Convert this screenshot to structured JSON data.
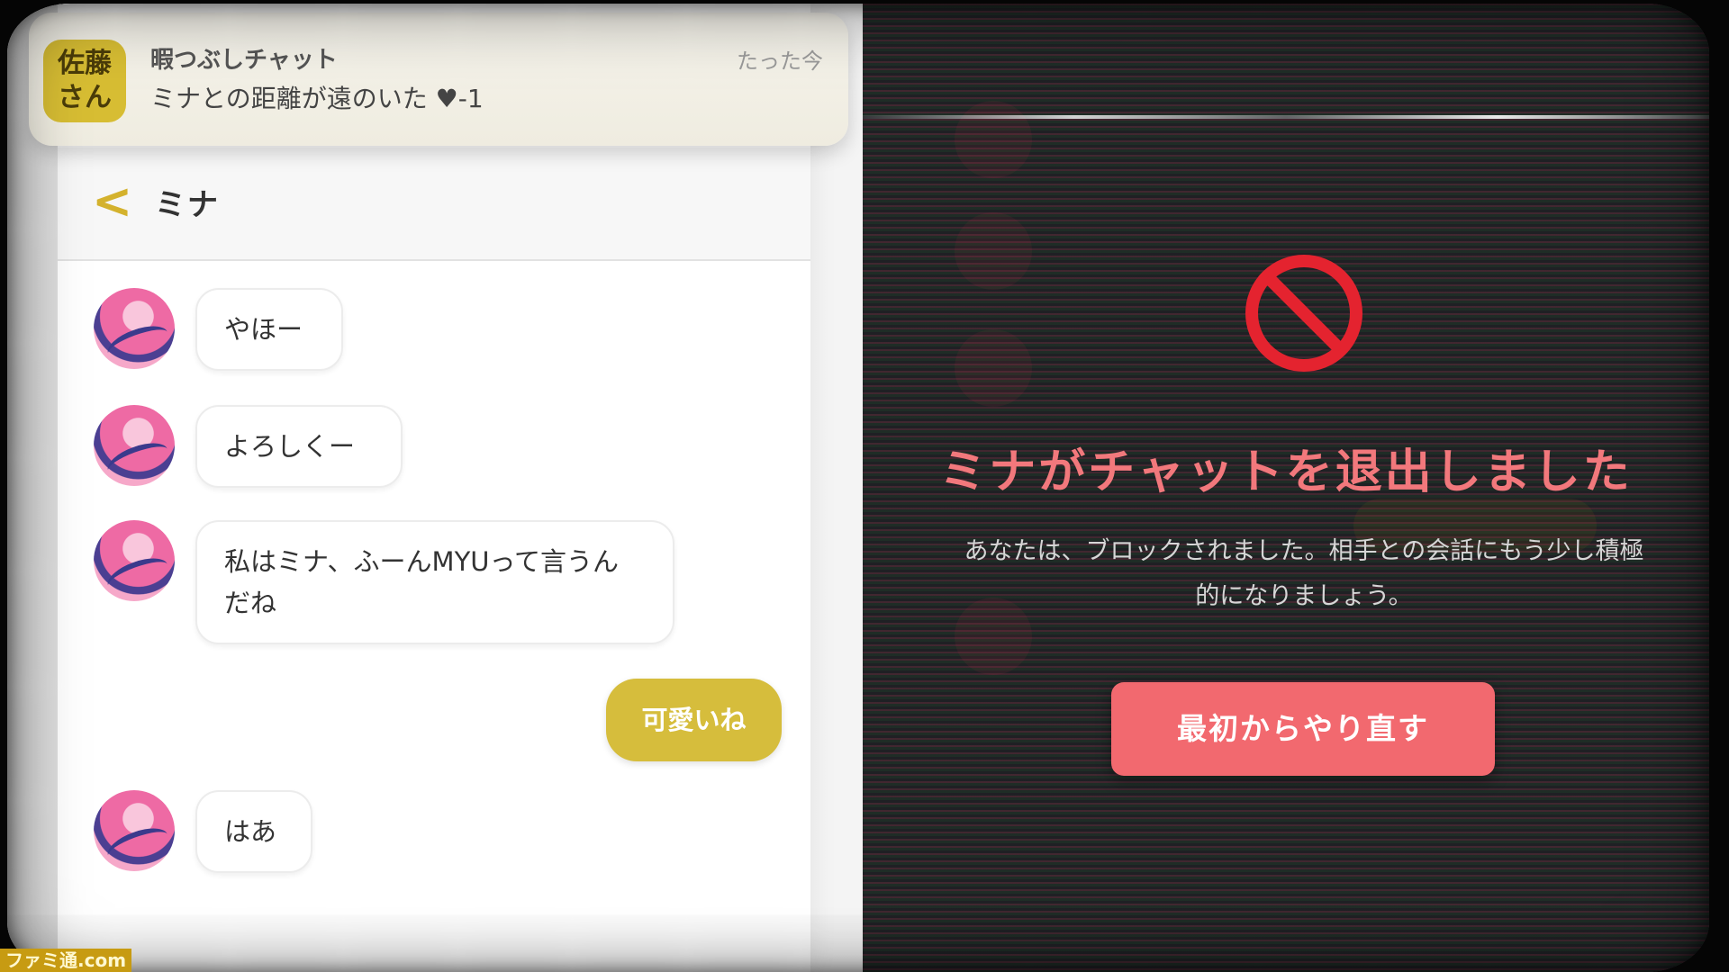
{
  "notification": {
    "avatar_line1": "佐藤",
    "avatar_line2": "さん",
    "app_name": "暇つぶしチャット",
    "time": "たった今",
    "message": "ミナとの距離が遠のいた",
    "heart_change": "-1",
    "heart_icon": "heart-icon"
  },
  "chat": {
    "back_label": "<",
    "title": "ミナ",
    "messages": [
      {
        "sender": "ミナ",
        "text": "やほー"
      },
      {
        "sender": "ミナ",
        "text": "よろしくー"
      },
      {
        "sender": "ミナ",
        "text": "私はミナ、ふーんMYUって言うんだね"
      },
      {
        "sender": "me",
        "text": "可愛いね"
      },
      {
        "sender": "ミナ",
        "text": "はあ"
      }
    ]
  },
  "blocked_panel": {
    "title": "ミナがチャットを退出しました",
    "description": "あなたは、ブロックされました。相手との会話にもう少し積極的になりましょう。",
    "restart_button": "最初からやり直す",
    "icon": "prohibited-icon"
  },
  "watermark": "ファミ通.com",
  "colors": {
    "accent_gold": "#d6bd3c",
    "alert_red": "#f2696f",
    "title_pink": "#f2787c"
  }
}
